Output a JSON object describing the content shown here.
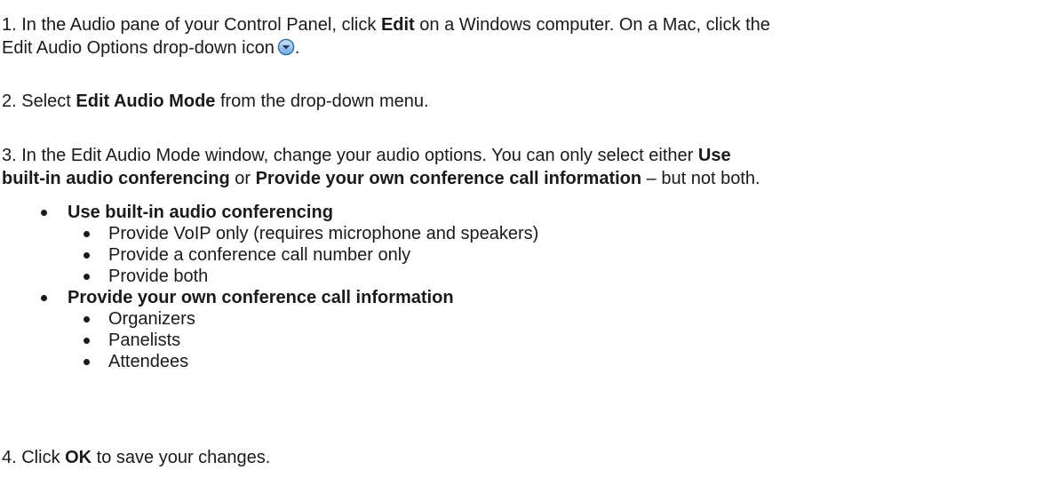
{
  "steps": {
    "step1": {
      "line1_a": "1. In the Audio pane of your Control Panel, click ",
      "line1_bold": "Edit",
      "line1_b": " on a Windows computer. On a Mac, click the",
      "line2_a": "Edit Audio Options drop-down icon",
      "line2_b": ".",
      "icon": "dropdown-circle-icon"
    },
    "step2": {
      "a": "2. Select ",
      "bold": "Edit Audio Mode",
      "b": " from the drop-down menu."
    },
    "step3": {
      "line1_a": "3. In the Edit Audio Mode window, change your audio options. You can only select either ",
      "line1_bold": "Use",
      "line2_bold1": "built-in audio conferencing",
      "line2_mid": " or ",
      "line2_bold2": "Provide your own conference call information",
      "line2_b": " – but not both."
    },
    "step4": {
      "a": "4. Click ",
      "bold": "OK",
      "b": " to save your changes."
    }
  },
  "options": [
    {
      "label": "Use built-in audio conferencing",
      "subitems": [
        "Provide VoIP only (requires microphone and speakers)",
        "Provide a conference call number only",
        "Provide both"
      ]
    },
    {
      "label": "Provide your own conference call information",
      "subitems": [
        "Organizers",
        "Panelists",
        "Attendees"
      ]
    }
  ],
  "colors": {
    "text": "#1a1a1a",
    "icon_fill": "#5b9bd5",
    "icon_stroke": "#2e6da4"
  }
}
